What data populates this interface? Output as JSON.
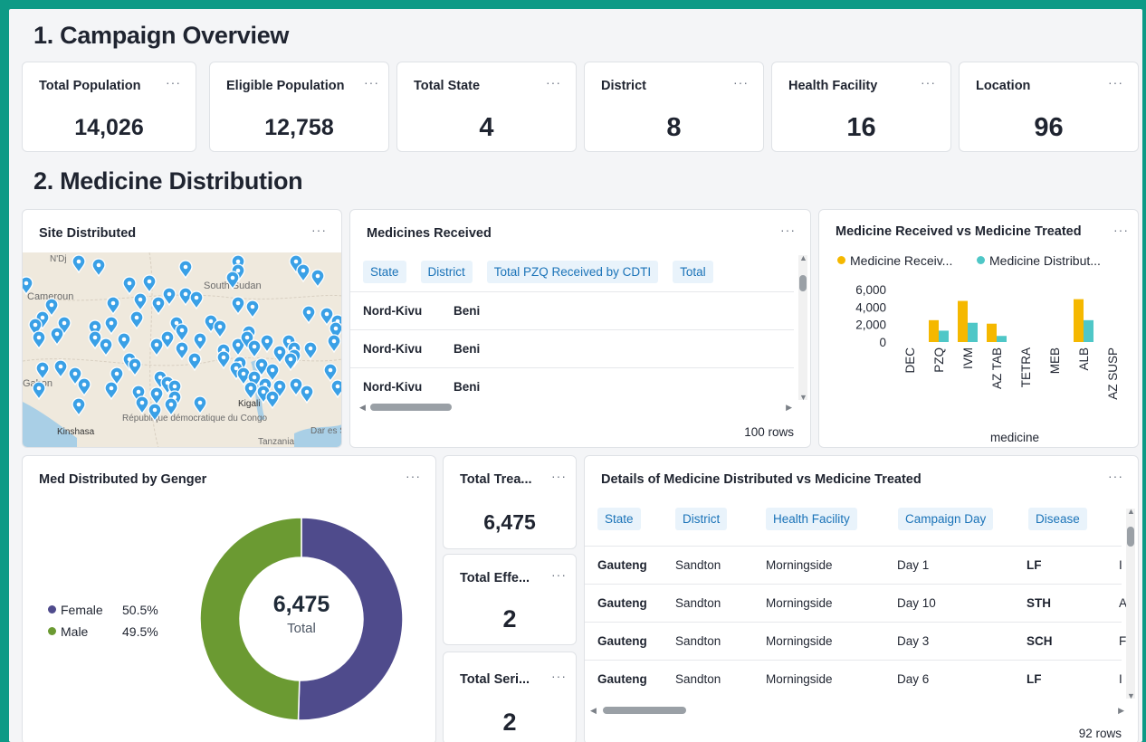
{
  "sections": {
    "overview_title": "1. Campaign Overview",
    "distribution_title": "2. Medicine Distribution"
  },
  "kpis": [
    {
      "label": "Total Population",
      "value": "14,026"
    },
    {
      "label": "Eligible Population",
      "value": "12,758"
    },
    {
      "label": "Total State",
      "value": "4"
    },
    {
      "label": "District",
      "value": "8"
    },
    {
      "label": "Health Facility",
      "value": "16"
    },
    {
      "label": "Location",
      "value": "96"
    }
  ],
  "menu_glyph": "···",
  "site_map": {
    "title": "Site Distributed",
    "labels": [
      "N'Dj",
      "Cameroun",
      "South Sudan",
      "Gabon",
      "Kinshasa",
      "République démocratique du Congo",
      "Kigali",
      "Tanzania",
      "Dar es Salaam"
    ],
    "pin_color": "#3aa0e6"
  },
  "medicines_received": {
    "title": "Medicines Received",
    "columns": [
      "State",
      "District",
      "Total PZQ Received by CDTI",
      "Total"
    ],
    "rows": [
      [
        "Nord-Kivu",
        "Beni"
      ],
      [
        "Nord-Kivu",
        "Beni"
      ],
      [
        "Nord-Kivu",
        "Beni"
      ]
    ],
    "rows_count": "100 rows"
  },
  "received_vs_treated": {
    "title": "Medicine Received vs Medicine Treated"
  },
  "chart_data": {
    "type": "bar",
    "title": "Medicine Received vs Medicine Treated",
    "xlabel": "medicine",
    "ylabel": "",
    "categories": [
      "DEC",
      "PZQ",
      "IVM",
      "AZ TAB",
      "TETRA",
      "MEB",
      "ALB",
      "AZ SUSP"
    ],
    "series": [
      {
        "name": "Medicine Receiv...",
        "color": "#f5b800",
        "values": [
          0,
          2500,
          4700,
          2100,
          0,
          0,
          4900,
          0
        ]
      },
      {
        "name": "Medicine Distribut...",
        "color": "#4fc7c7",
        "values": [
          0,
          1300,
          2200,
          700,
          0,
          0,
          2500,
          0
        ]
      }
    ],
    "yticks": [
      "6,000",
      "4,000",
      "2,000",
      "0"
    ],
    "ylim": [
      0,
      6000
    ],
    "legend": "top"
  },
  "gender": {
    "title": "Med Distributed by Genger",
    "center_value": "6,475",
    "center_label": "Total",
    "items": [
      {
        "label": "Female",
        "pct": "50.5%",
        "value": 50.5,
        "color": "#4f4b8c"
      },
      {
        "label": "Male",
        "pct": "49.5%",
        "value": 49.5,
        "color": "#6b9a32"
      }
    ]
  },
  "mini_kpis": [
    {
      "label": "Total Trea...",
      "value": "6,475"
    },
    {
      "label": "Total Effe...",
      "value": "2"
    },
    {
      "label": "Total Seri...",
      "value": "2"
    }
  ],
  "details": {
    "title": "Details of Medicine Distributed vs Medicine Treated",
    "columns": [
      "State",
      "District",
      "Health Facility",
      "Campaign Day",
      "Disease"
    ],
    "rows": [
      [
        "Gauteng",
        "Sandton",
        "Morningside",
        "Day 1",
        "LF",
        "I"
      ],
      [
        "Gauteng",
        "Sandton",
        "Morningside",
        "Day 10",
        "STH",
        "A"
      ],
      [
        "Gauteng",
        "Sandton",
        "Morningside",
        "Day 3",
        "SCH",
        "F"
      ],
      [
        "Gauteng",
        "Sandton",
        "Morningside",
        "Day 6",
        "LF",
        "I"
      ]
    ],
    "rows_count": "92 rows"
  }
}
